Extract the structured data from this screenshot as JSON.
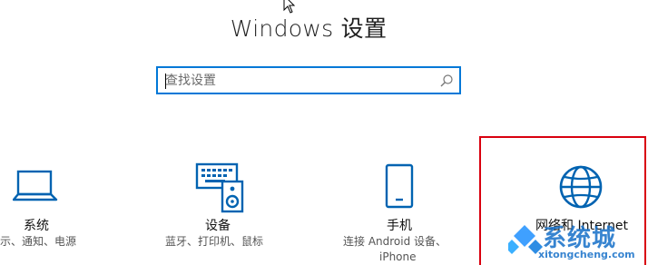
{
  "header": {
    "title": "Windows 设置"
  },
  "search": {
    "placeholder": "查找设置",
    "value": ""
  },
  "tiles": [
    {
      "name": "系统",
      "desc_lines": [
        "示、通知、电源"
      ]
    },
    {
      "name": "设备",
      "desc_lines": [
        "蓝牙、打印机、鼠标"
      ]
    },
    {
      "name": "手机",
      "desc_lines": [
        "连接 Android 设备、",
        "iPhone"
      ]
    },
    {
      "name": "网络和 Internet",
      "desc_lines": []
    }
  ],
  "watermark": {
    "text": "系统城",
    "url": "xitongcheng.com"
  },
  "colors": {
    "accent": "#0078d7",
    "highlight_border": "#d9000f",
    "icon": "#0063b1"
  },
  "icons": [
    "cursor-icon",
    "search-icon",
    "laptop-icon",
    "keyboard-speaker-icon",
    "phone-icon",
    "globe-icon"
  ]
}
